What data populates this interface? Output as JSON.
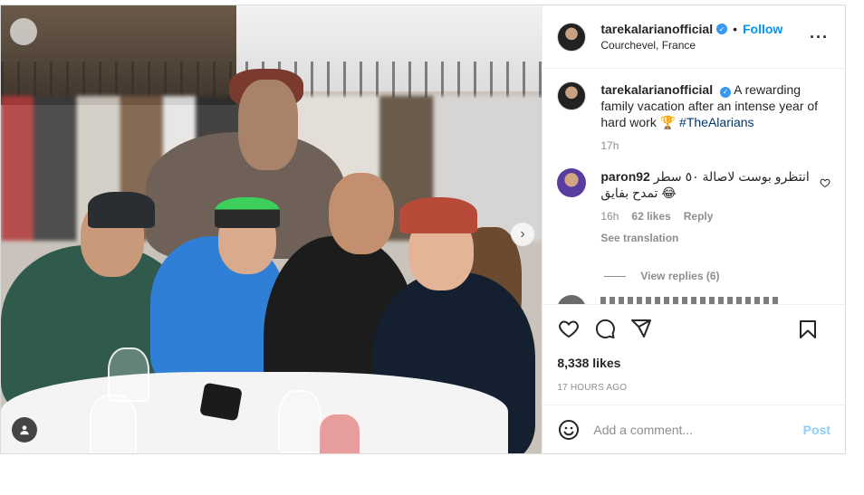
{
  "post": {
    "username": "tarekalarianofficial",
    "follow_label": "Follow",
    "location": "Courchevel, France",
    "more_icon": "more-options-icon",
    "caption": {
      "username": "tarekalarianofficial",
      "text": "A rewarding family vacation after an intense year of hard work 🏆 ",
      "hashtag": "#TheAlarians",
      "time": "17h"
    },
    "comments": [
      {
        "username": "paron92",
        "text": "انتظرو بوست لاصالة ٥٠ سطر تمدح بفايق 😂",
        "time": "16h",
        "likes": "62 likes",
        "reply_label": "Reply",
        "see_translation": "See translation",
        "view_replies": "View replies (6)"
      }
    ],
    "likes": "8,338 likes",
    "posted_ago": "17 HOURS AGO",
    "add_comment_placeholder": "Add a comment...",
    "post_label": "Post"
  },
  "icons": {
    "like": "heart-icon",
    "comment": "comment-icon",
    "share": "share-icon",
    "save": "bookmark-icon",
    "emoji": "emoji-icon",
    "tag": "user-tag-icon"
  },
  "colors": {
    "accent": "#0095f6",
    "verified": "#3897f0",
    "muted": "#8e8e8e",
    "text": "#262626"
  }
}
